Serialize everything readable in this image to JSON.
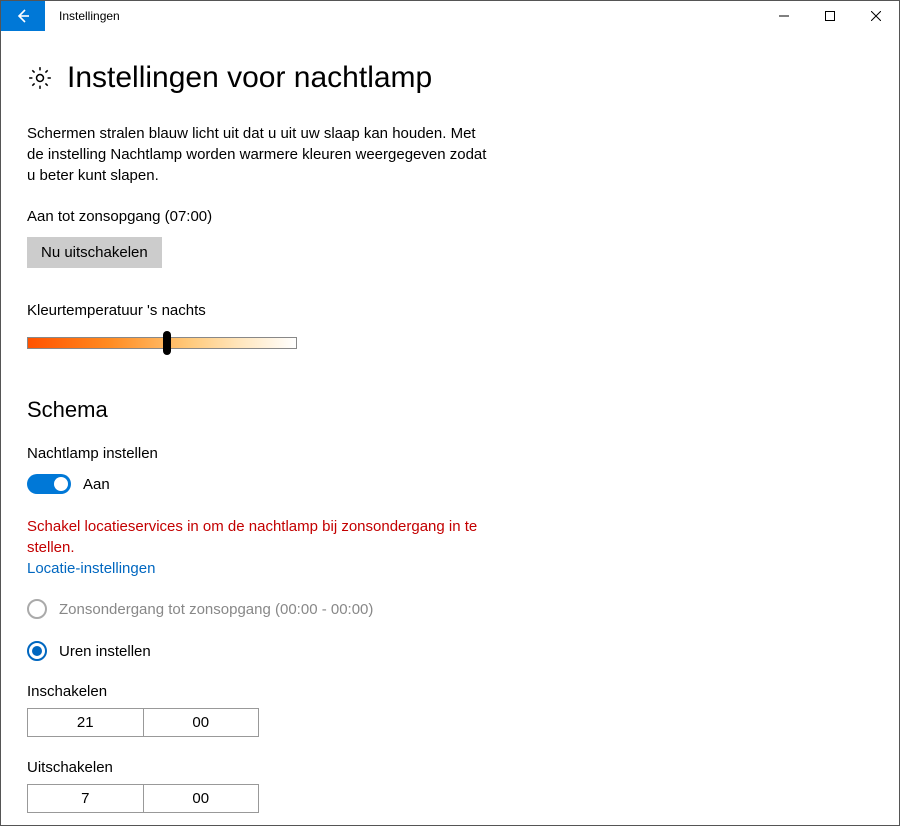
{
  "titlebar": {
    "app_title": "Instellingen"
  },
  "page": {
    "title": "Instellingen voor nachtlamp",
    "description": "Schermen stralen blauw licht uit dat u uit uw slaap kan houden. Met de instelling Nachtlamp worden warmere kleuren weergegeven zodat u beter kunt slapen.",
    "status": "Aan tot zonsopgang (07:00)",
    "disable_now_label": "Nu uitschakelen",
    "temperature_label": "Kleurtemperatuur 's nachts",
    "temperature_percent": 52
  },
  "schema": {
    "heading": "Schema",
    "toggle_label": "Nachtlamp instellen",
    "toggle_state": "Aan",
    "warning": "Schakel locatieservices in om de nachtlamp bij zonsondergang in te stellen.",
    "location_link": "Locatie-instellingen",
    "radio_sunset": "Zonsondergang tot zonsopgang (00:00 - 00:00)",
    "radio_hours": "Uren instellen",
    "turn_on_label": "Inschakelen",
    "turn_on_hour": "21",
    "turn_on_minute": "00",
    "turn_off_label": "Uitschakelen",
    "turn_off_hour": "7",
    "turn_off_minute": "00"
  }
}
